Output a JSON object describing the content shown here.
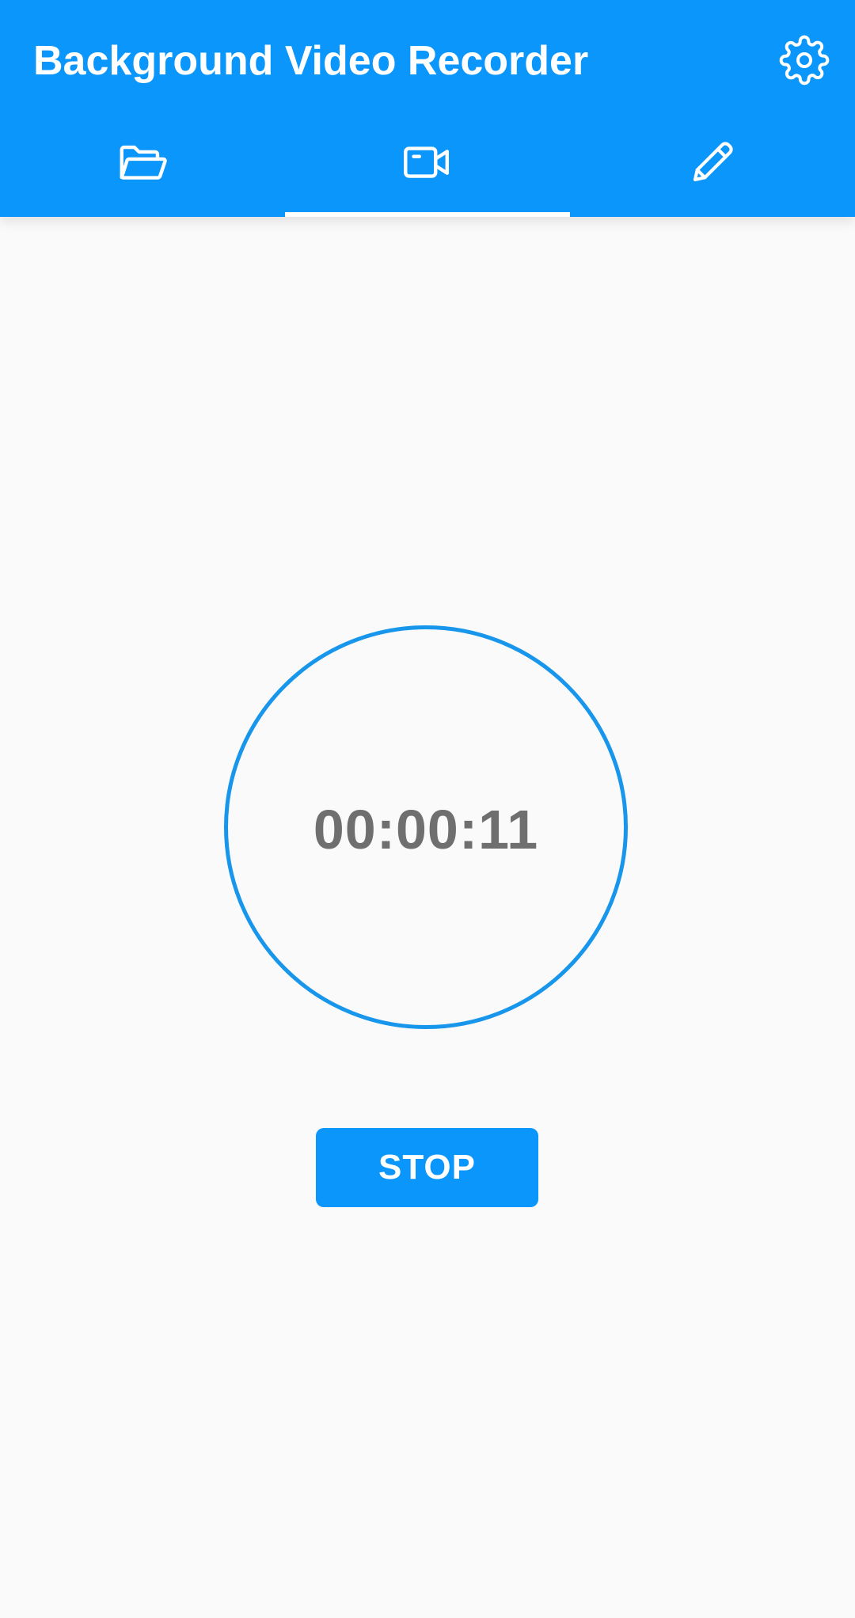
{
  "app": {
    "title": "Background Video Recorder",
    "accent_color": "#0b96fb",
    "ring_color": "#1796ec"
  },
  "header": {
    "settings_icon": "gear-icon"
  },
  "tabs": [
    {
      "icon": "folder-open-icon",
      "active": false
    },
    {
      "icon": "video-camera-icon",
      "active": true
    },
    {
      "icon": "pencil-icon",
      "active": false
    }
  ],
  "recorder": {
    "elapsed": "00:00:11",
    "stop_label": "STOP"
  }
}
